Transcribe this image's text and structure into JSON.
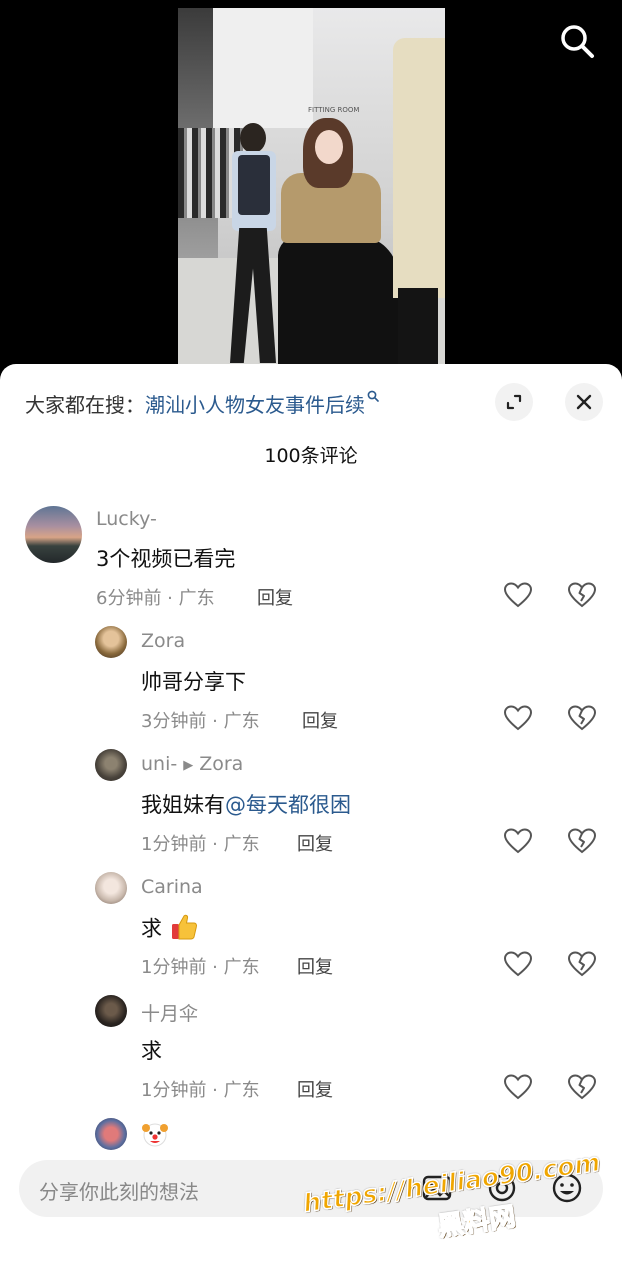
{
  "header": {
    "search_prefix": "大家都在搜：",
    "search_topic": "潮汕小人物女友事件后续",
    "comment_count": "100条评论"
  },
  "video": {
    "sign_text": "FITTING ROOM"
  },
  "comments": [
    {
      "user": "Lucky-",
      "text": "3个视频已看完",
      "meta": "6分钟前 · 广东",
      "reply": "回复"
    },
    {
      "user": "Zora",
      "text": "帅哥分享下",
      "meta": "3分钟前 · 广东",
      "reply": "回复"
    },
    {
      "user": "uni-",
      "reply_to": "Zora",
      "text": "我姐妹有",
      "mention": "@每天都很困",
      "meta": "1分钟前 · 广东",
      "reply": "回复"
    },
    {
      "user": "Carina",
      "text": "求",
      "meta": "1分钟前 · 广东",
      "reply": "回复"
    },
    {
      "user": "十月伞",
      "text": "求",
      "meta": "1分钟前 · 广东",
      "reply": "回复"
    }
  ],
  "input": {
    "placeholder": "分享你此刻的想法"
  },
  "watermark": {
    "url": "https://heiliao90.com",
    "name": "黑料网"
  },
  "colors": {
    "link": "#2b5a8e",
    "watermark": "#f0a600"
  }
}
